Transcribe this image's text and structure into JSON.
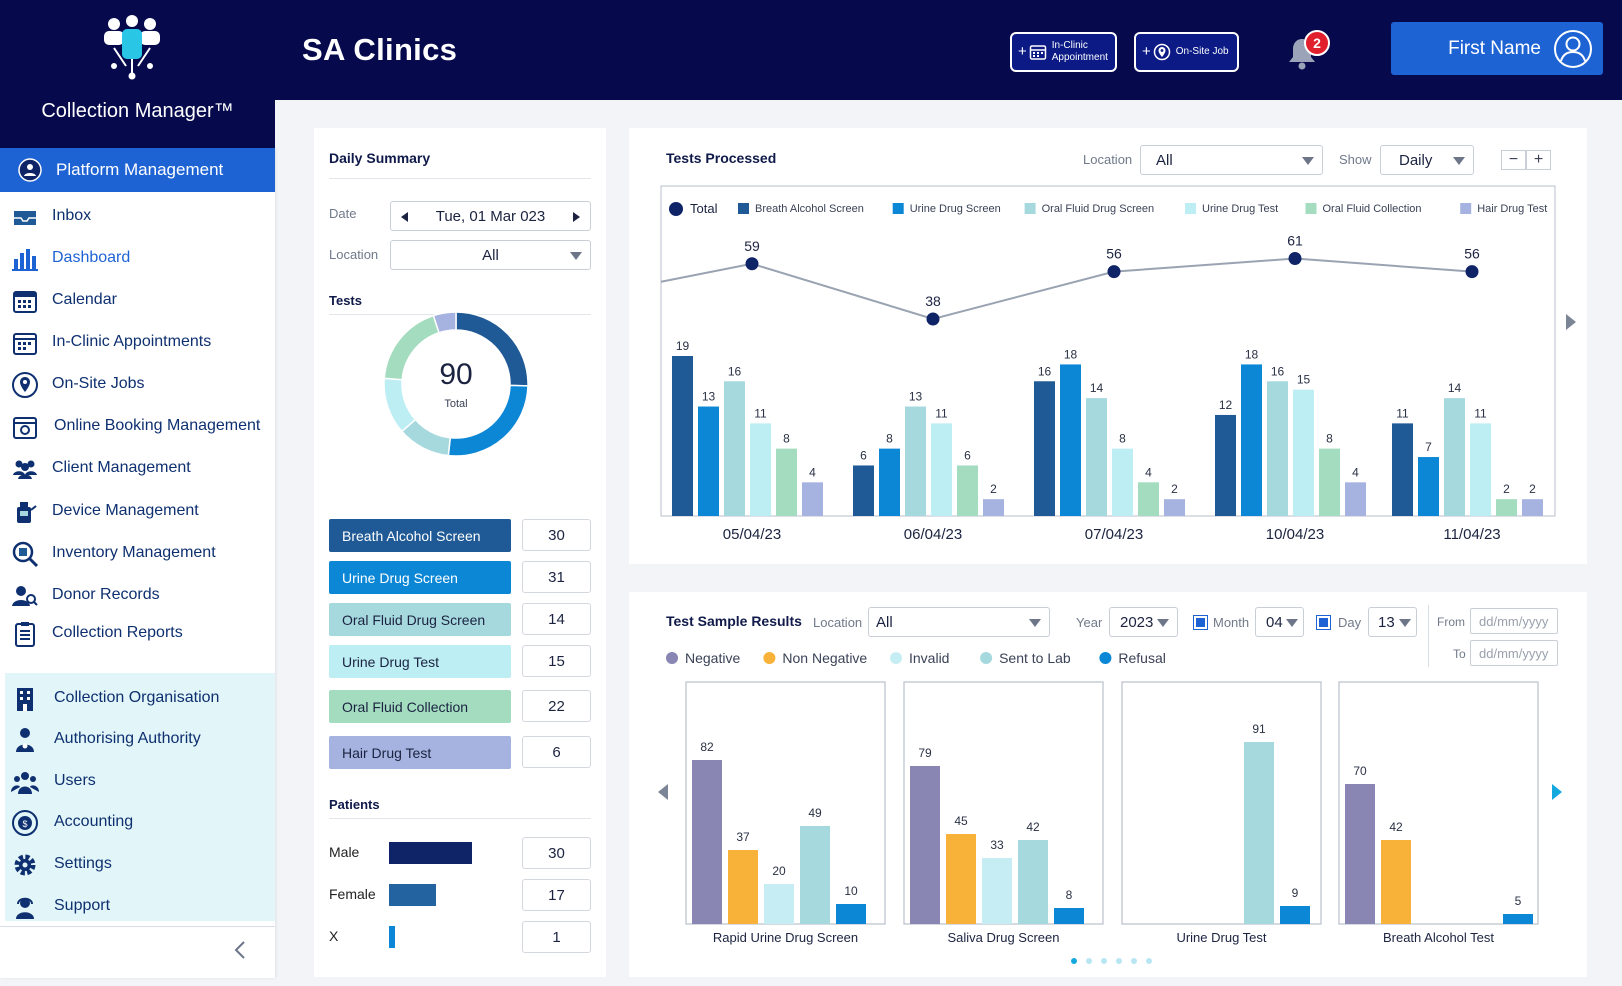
{
  "app": {
    "brand_name": "Collection Manager™",
    "title": "SA Clinics"
  },
  "header": {
    "in_clinic_line1": "In-Clinic",
    "in_clinic_line2": "Appointment",
    "onsite_label": "On-Site Job",
    "notification_count": "2",
    "user_name": "First Name"
  },
  "sidebar": {
    "active": "Platform Management",
    "items": [
      "Inbox",
      "Dashboard",
      "Calendar",
      "In-Clinic Appointments",
      "On-Site Jobs",
      "Online Booking Management",
      "Client Management",
      "Device Management",
      "Inventory Management",
      "Donor Records",
      "Collection Reports"
    ],
    "group": [
      "Collection Organisation",
      "Authorising Authority",
      "Users",
      "Accounting",
      "Settings",
      "Support"
    ]
  },
  "daily_summary": {
    "title": "Daily Summary",
    "date_label": "Date",
    "date_value": "Tue, 01 Mar 023",
    "location_label": "Location",
    "location_value": "All",
    "tests_heading": "Tests",
    "donut_total": "90",
    "donut_caption": "Total",
    "tests": [
      {
        "name": "Breath Alcohol Screen",
        "count": "30",
        "color": "#1f5a96",
        "text_color": "#ffffff"
      },
      {
        "name": "Urine Drug Screen",
        "count": "31",
        "color": "#0b87d6",
        "text_color": "#ffffff"
      },
      {
        "name": "Oral Fluid Drug Screen",
        "count": "14",
        "color": "#a6d9de",
        "text_color": "#1b2340"
      },
      {
        "name": "Urine Drug Test",
        "count": "15",
        "color": "#bdeef4",
        "text_color": "#1b2340"
      },
      {
        "name": "Oral Fluid Collection",
        "count": "22",
        "color": "#a3dcbf",
        "text_color": "#1b2340"
      },
      {
        "name": "Hair Drug Test",
        "count": "6",
        "color": "#a6b3e0",
        "text_color": "#1b2340"
      }
    ],
    "patients_heading": "Patients",
    "patients": [
      {
        "label": "Male",
        "count": "30",
        "value": 30,
        "color": "#0e2467"
      },
      {
        "label": "Female",
        "count": "17",
        "value": 17,
        "color": "#2263a0"
      },
      {
        "label": "X",
        "count": "1",
        "value": 1,
        "color": "#0b87d6"
      }
    ]
  },
  "tests_processed": {
    "title": "Tests Processed",
    "location_label": "Location",
    "location_value": "All",
    "show_label": "Show",
    "show_value": "Daily"
  },
  "sample_results": {
    "title": "Test Sample Results",
    "location_label": "Location",
    "location_value": "All",
    "year_label": "Year",
    "year_value": "2023",
    "month_label": "Month",
    "month_value": "04",
    "day_label": "Day",
    "day_value": "13",
    "from_label": "From",
    "to_label": "To",
    "date_placeholder": "dd/mm/yyyy"
  },
  "chart_data": [
    {
      "type": "bar",
      "title": "Tests Processed",
      "categories": [
        "05/04/23",
        "06/04/23",
        "07/04/23",
        "10/04/23",
        "11/04/23"
      ],
      "series": [
        {
          "name": "Breath Alcohol Screen",
          "values": [
            19,
            6,
            16,
            12,
            11
          ],
          "color": "#1f5a96"
        },
        {
          "name": "Urine Drug Screen",
          "values": [
            13,
            8,
            18,
            18,
            7
          ],
          "color": "#0b87d6"
        },
        {
          "name": "Oral Fluid Drug Screen",
          "values": [
            16,
            13,
            14,
            16,
            14
          ],
          "color": "#a6d9de"
        },
        {
          "name": "Urine Drug Test",
          "values": [
            11,
            11,
            8,
            15,
            11
          ],
          "color": "#bdeef4"
        },
        {
          "name": "Oral Fluid Collection",
          "values": [
            8,
            6,
            4,
            8,
            2
          ],
          "color": "#a3dcbf"
        },
        {
          "name": "Hair Drug Test",
          "values": [
            4,
            2,
            2,
            4,
            2
          ],
          "color": "#a6b3e0"
        }
      ],
      "total": {
        "name": "Total",
        "values": [
          59,
          38,
          56,
          61,
          56
        ],
        "color": "#0e2467"
      },
      "legend_position": "top",
      "grid": false
    },
    {
      "type": "bar",
      "title": "Test Sample Results",
      "categories": [
        "Rapid Urine Drug Screen",
        "Saliva Drug Screen",
        "Urine Drug Test",
        "Breath Alcohol Test"
      ],
      "series": [
        {
          "name": "Negative",
          "values": [
            82,
            79,
            null,
            70
          ],
          "color": "#8a86b4"
        },
        {
          "name": "Non Negative",
          "values": [
            37,
            45,
            null,
            42
          ],
          "color": "#f8b23a"
        },
        {
          "name": "Invalid",
          "values": [
            20,
            33,
            null,
            null
          ],
          "color": "#c7edf4"
        },
        {
          "name": "Sent to Lab",
          "values": [
            49,
            42,
            91,
            null
          ],
          "color": "#a6d9de"
        },
        {
          "name": "Refusal",
          "values": [
            10,
            8,
            9,
            5
          ],
          "color": "#0b87d6"
        }
      ],
      "legend_position": "top",
      "grid": false
    }
  ]
}
